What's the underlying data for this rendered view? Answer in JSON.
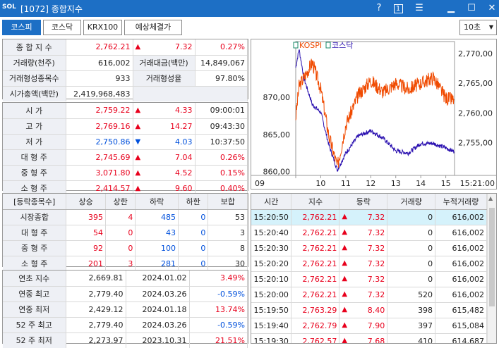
{
  "window": {
    "logo": "SOL",
    "title": "[1072] 종합지수",
    "help": "?",
    "page": "1"
  },
  "tabs": [
    "코스피",
    "코스닥",
    "KRX100",
    "예상체결가"
  ],
  "interval": "10초",
  "summary": {
    "index_label": "종 합 지 수",
    "index_value": "2,762.21",
    "index_change": "7.32",
    "index_rate": "0.27%",
    "vol_label": "거래량(천주)",
    "vol_value": "616,002",
    "amt_label": "거래대금(백만)",
    "amt_value": "14,849,067",
    "formed_cnt_label": "거래형성종목수",
    "formed_cnt_value": "933",
    "formed_rate_label": "거래형성율",
    "formed_rate_value": "97.80%",
    "mktcap_label": "시가총액(백만)",
    "mktcap_value": "2,419,968,483"
  },
  "prices": [
    {
      "label": "시 가",
      "value": "2,759.22",
      "dir": "up",
      "change": "4.33",
      "extra": "09:00:01"
    },
    {
      "label": "고 가",
      "value": "2,769.16",
      "dir": "up",
      "change": "14.27",
      "extra": "09:43:30"
    },
    {
      "label": "저 가",
      "value": "2,750.86",
      "dir": "down",
      "change": "4.03",
      "extra": "10:37:50"
    },
    {
      "label": "대 형 주",
      "value": "2,745.69",
      "dir": "up",
      "change": "7.04",
      "extra": "0.26%"
    },
    {
      "label": "중 형 주",
      "value": "3,071.80",
      "dir": "up",
      "change": "4.52",
      "extra": "0.15%"
    },
    {
      "label": "소 형 주",
      "value": "2,414.57",
      "dir": "up",
      "change": "9.60",
      "extra": "0.40%"
    }
  ],
  "breadth": {
    "headers": [
      "[등락종목수]",
      "상승",
      "상한",
      "하락",
      "하한",
      "보합"
    ],
    "rows": [
      {
        "label": "시장종합",
        "up": "395",
        "upper": "4",
        "down": "485",
        "lower": "0",
        "flat": "53"
      },
      {
        "label": "대 형 주",
        "up": "54",
        "upper": "0",
        "down": "43",
        "lower": "0",
        "flat": "3"
      },
      {
        "label": "중 형 주",
        "up": "92",
        "upper": "0",
        "down": "100",
        "lower": "0",
        "flat": "8"
      },
      {
        "label": "소 형 주",
        "up": "201",
        "upper": "3",
        "down": "281",
        "lower": "0",
        "flat": "30"
      }
    ]
  },
  "yearly": [
    {
      "label": "연초 지수",
      "value": "2,669.81",
      "date": "2024.01.02",
      "rate": "3.49%",
      "sign": "up"
    },
    {
      "label": "연중 최고",
      "value": "2,779.40",
      "date": "2024.03.26",
      "rate": "-0.59%",
      "sign": "down"
    },
    {
      "label": "연중 최저",
      "value": "2,429.12",
      "date": "2024.01.18",
      "rate": "13.74%",
      "sign": "up"
    },
    {
      "label": "52 주 최고",
      "value": "2,779.40",
      "date": "2024.03.26",
      "rate": "-0.59%",
      "sign": "down"
    },
    {
      "label": "52 주 최저",
      "value": "2,273.97",
      "date": "2023.10.31",
      "rate": "21.51%",
      "sign": "up"
    }
  ],
  "ticks": {
    "headers": [
      "시간",
      "지수",
      "등락",
      "거래량",
      "누적거래량"
    ],
    "rows": [
      {
        "time": "15:20:50",
        "index": "2,762.21",
        "change": "7.32",
        "vol": "0",
        "cum": "616,002"
      },
      {
        "time": "15:20:40",
        "index": "2,762.21",
        "change": "7.32",
        "vol": "0",
        "cum": "616,002"
      },
      {
        "time": "15:20:30",
        "index": "2,762.21",
        "change": "7.32",
        "vol": "0",
        "cum": "616,002"
      },
      {
        "time": "15:20:20",
        "index": "2,762.21",
        "change": "7.32",
        "vol": "0",
        "cum": "616,002"
      },
      {
        "time": "15:20:10",
        "index": "2,762.21",
        "change": "7.32",
        "vol": "0",
        "cum": "616,002"
      },
      {
        "time": "15:20:00",
        "index": "2,762.21",
        "change": "7.32",
        "vol": "520",
        "cum": "616,002"
      },
      {
        "time": "15:19:50",
        "index": "2,763.29",
        "change": "8.40",
        "vol": "398",
        "cum": "615,482"
      },
      {
        "time": "15:19:40",
        "index": "2,762.79",
        "change": "7.90",
        "vol": "397",
        "cum": "615,084"
      },
      {
        "time": "15:19:30",
        "index": "2,762.57",
        "change": "7.68",
        "vol": "410",
        "cum": "614,687"
      }
    ]
  },
  "chart_data": {
    "type": "line",
    "legend": [
      "KOSPI",
      "코스닥"
    ],
    "left_axis": {
      "ticks": [
        "870,00",
        "865,00",
        "860,00"
      ],
      "values": [
        870,
        865,
        860
      ],
      "ylim": [
        859.5,
        877.5
      ]
    },
    "right_axis": {
      "ticks": [
        "2,770,00",
        "2,765,00",
        "2,760,00",
        "2,755,00"
      ],
      "values": [
        2770,
        2765,
        2760,
        2755
      ],
      "ylim": [
        2749.5,
        2772
      ]
    },
    "x_ticks": [
      "09",
      "10",
      "11",
      "12",
      "13",
      "14",
      "15",
      "15:21:00"
    ],
    "colors": {
      "kospi": "#f04a00",
      "kosdaq": "#2a10b0"
    },
    "series": [
      {
        "name": "KOSPI",
        "x": [
          "09:00",
          "09:08",
          "09:20",
          "09:40",
          "10:00",
          "10:20",
          "10:40",
          "11:00",
          "11:30",
          "12:00",
          "12:30",
          "13:00",
          "13:30",
          "14:00",
          "14:30",
          "15:00",
          "15:20"
        ],
        "values": [
          2759.2,
          2764.5,
          2766.0,
          2768.5,
          2764.0,
          2756.0,
          2751.0,
          2758.0,
          2763.0,
          2765.5,
          2763.5,
          2765.0,
          2764.0,
          2765.0,
          2766.0,
          2762.5,
          2762.2
        ]
      },
      {
        "name": "코스닥",
        "x": [
          "09:00",
          "09:08",
          "09:20",
          "09:40",
          "10:00",
          "10:20",
          "10:40",
          "11:00",
          "11:30",
          "12:00",
          "12:30",
          "13:00",
          "13:30",
          "14:00",
          "14:30",
          "15:00",
          "15:20"
        ],
        "values": [
          874.0,
          876.5,
          872.5,
          869.0,
          868.0,
          863.5,
          860.2,
          862.5,
          864.8,
          865.5,
          864.5,
          862.8,
          862.5,
          863.8,
          863.8,
          863.2,
          862.7
        ]
      }
    ]
  }
}
